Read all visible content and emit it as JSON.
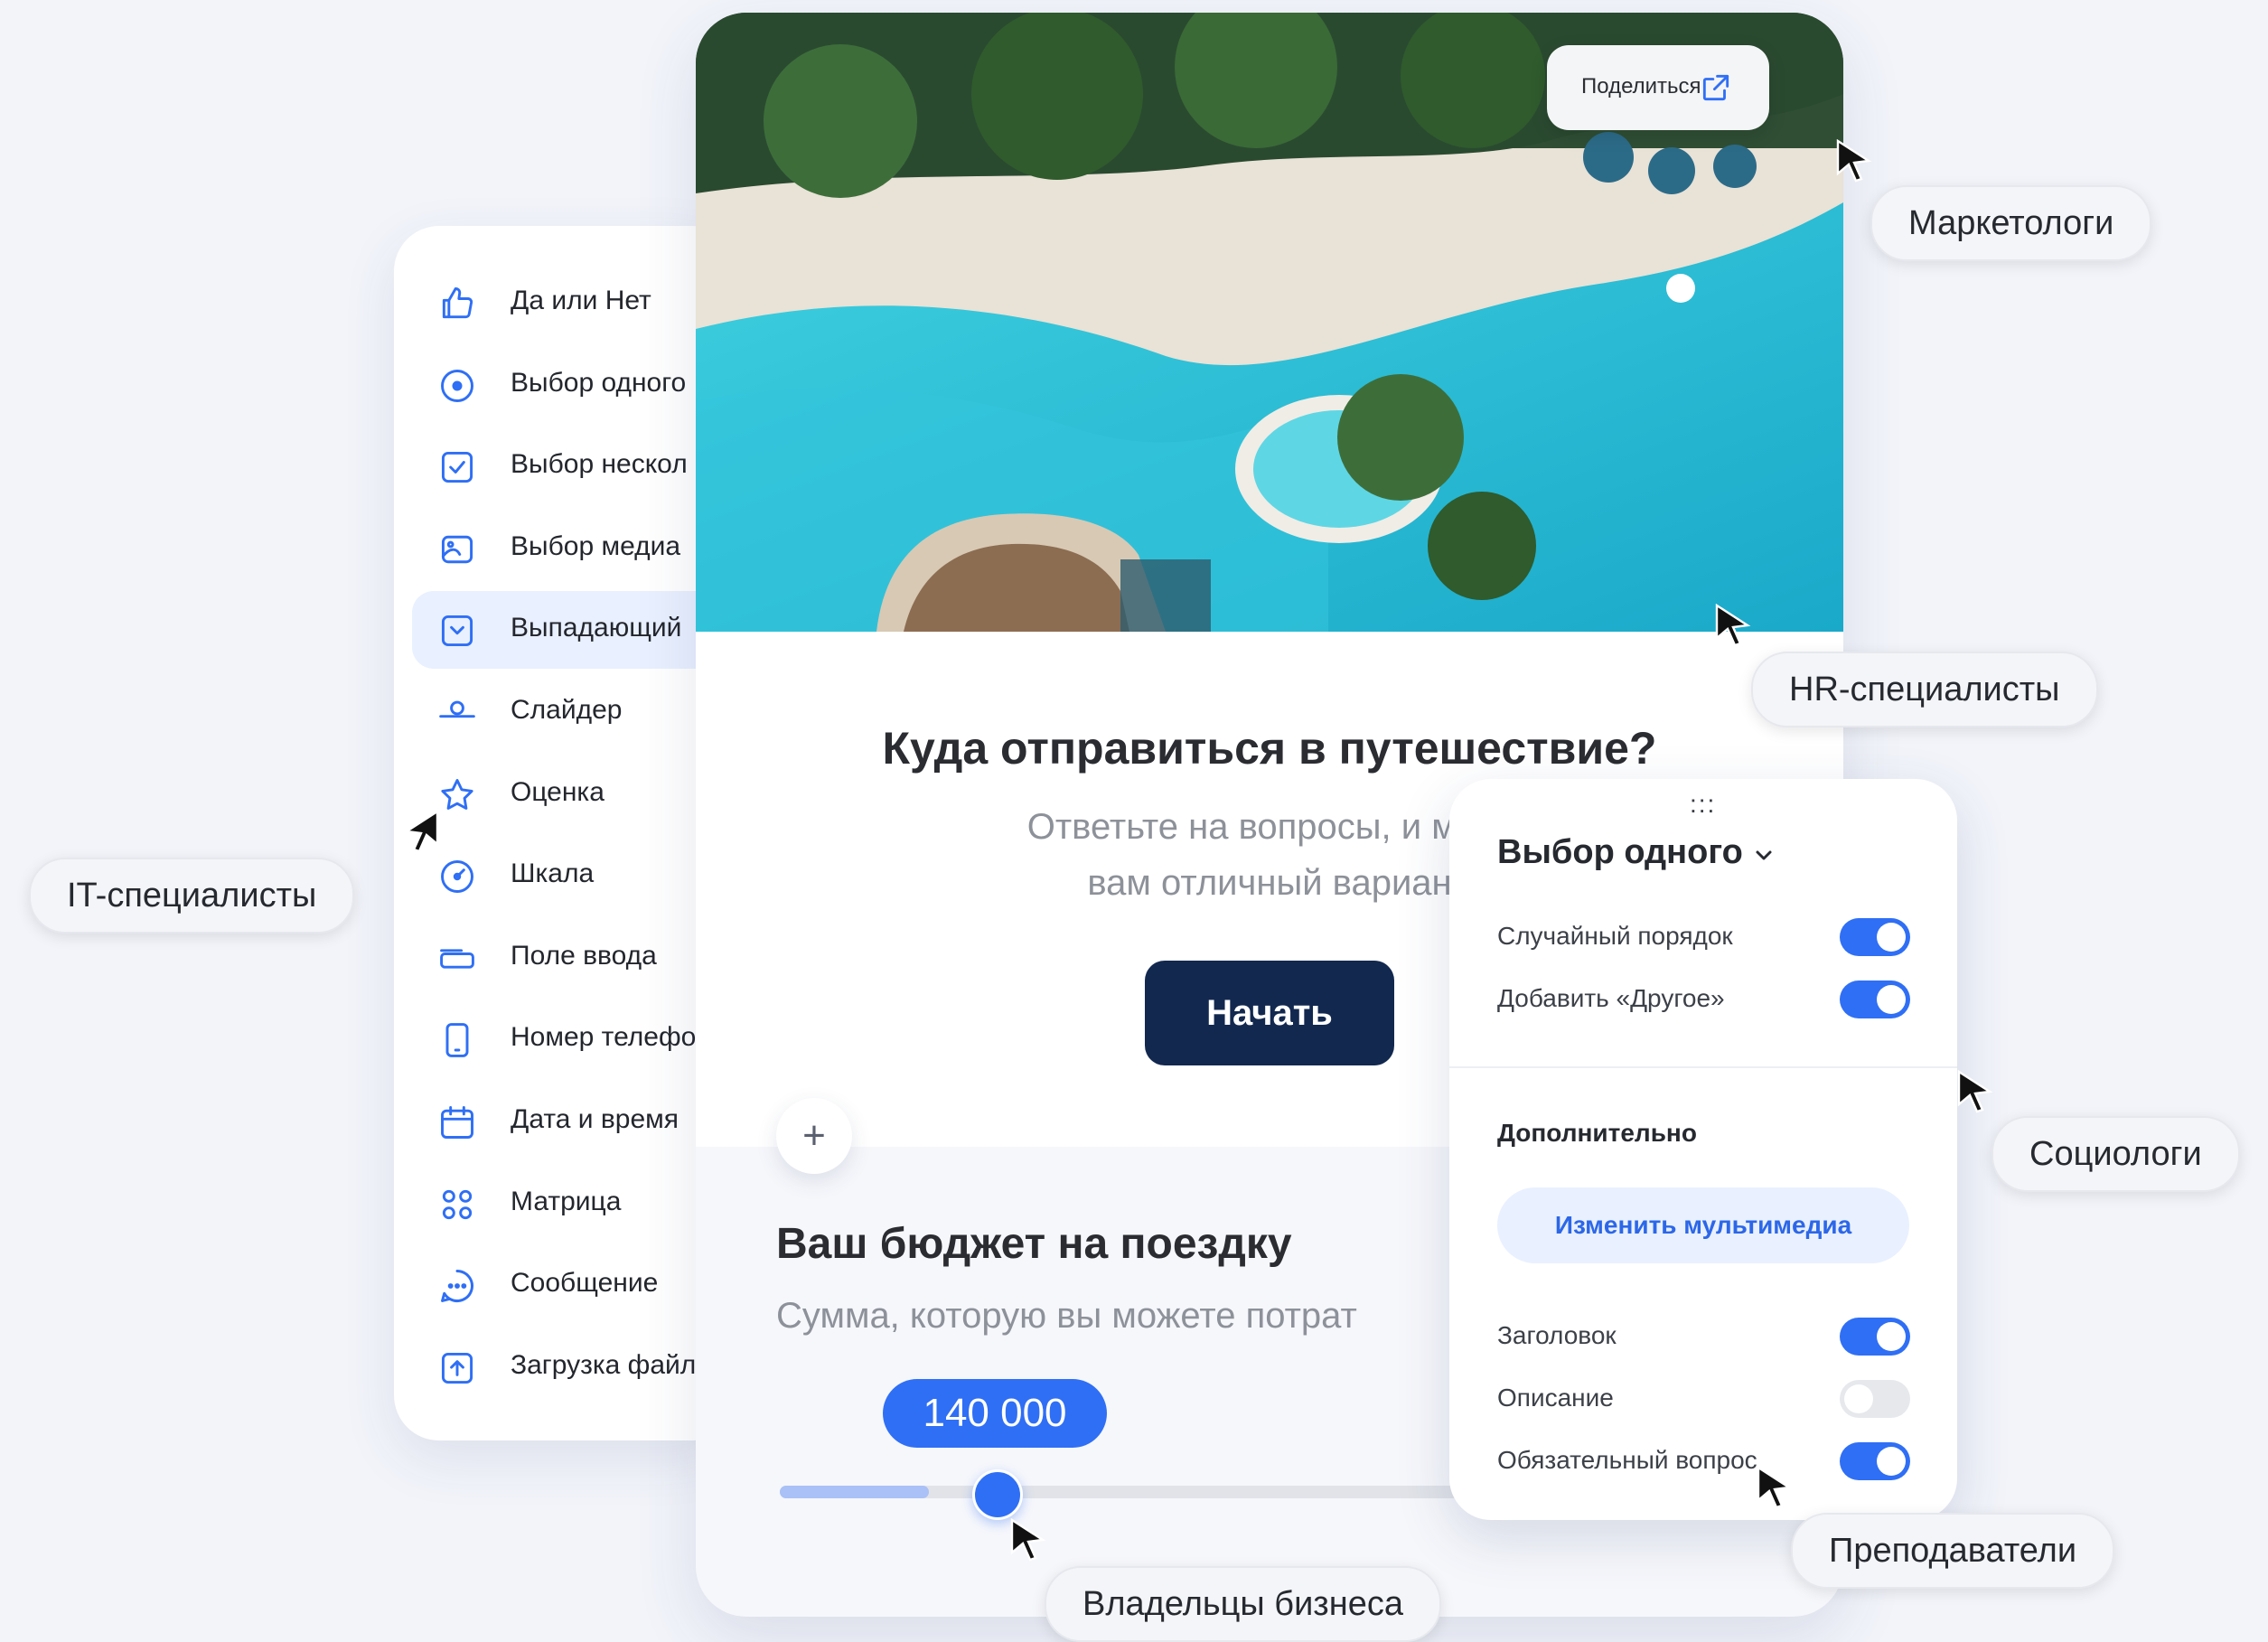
{
  "sidebar": {
    "items": [
      {
        "label": "Да или Нет",
        "icon": "thumbs-up-icon"
      },
      {
        "label": "Выбор одного",
        "icon": "radio-icon"
      },
      {
        "label": "Выбор нескол",
        "icon": "checkbox-icon"
      },
      {
        "label": "Выбор медиа",
        "icon": "image-icon"
      },
      {
        "label": "Выпадающий",
        "icon": "dropdown-icon",
        "active": true
      },
      {
        "label": "Слайдер",
        "icon": "slider-icon"
      },
      {
        "label": "Оценка",
        "icon": "star-icon"
      },
      {
        "label": "Шкала",
        "icon": "gauge-icon"
      },
      {
        "label": "Поле ввода",
        "icon": "input-field-icon"
      },
      {
        "label": "Номер телефо",
        "icon": "phone-icon"
      },
      {
        "label": "Дата и время",
        "icon": "calendar-icon"
      },
      {
        "label": "Матрица",
        "icon": "matrix-icon"
      },
      {
        "label": "Сообщение",
        "icon": "message-icon"
      },
      {
        "label": "Загрузка файл",
        "icon": "upload-icon"
      }
    ]
  },
  "survey": {
    "share_label": "Поделиться",
    "title": "Куда отправиться в путешествие?",
    "subtitle_line1": "Ответьте на вопросы, и мы п",
    "subtitle_line2": "вам отличный вариан",
    "start_label": "Начать",
    "add_label": "+",
    "budget_title": "Ваш бюджет на поездку",
    "budget_subtitle": "Сумма, которую вы можете потрат",
    "budget_value": "140 000",
    "slider_fraction": 0.14
  },
  "panel": {
    "drag_handle": ":::",
    "title": "Выбор одного",
    "options": [
      {
        "label": "Случайный порядок",
        "on": true
      },
      {
        "label": "Добавить «Другое»",
        "on": true
      }
    ],
    "extra_title": "Дополнительно",
    "media_button": "Изменить мультимедиа",
    "extra_options": [
      {
        "label": "Заголовок",
        "on": true
      },
      {
        "label": "Описание",
        "on": false
      },
      {
        "label": "Обязательный вопрос",
        "on": true
      }
    ]
  },
  "audiences": {
    "marketers": "Маркетологи",
    "hr": "HR-специалисты",
    "it": "IT-специалисты",
    "sociologists": "Социологи",
    "teachers": "Преподаватели",
    "business": "Владельцы бизнеса"
  },
  "colors": {
    "accent": "#2f6ff5",
    "primary_button": "#12284f",
    "background": "#f2f4fa",
    "active_item": "#e9f0ff"
  }
}
